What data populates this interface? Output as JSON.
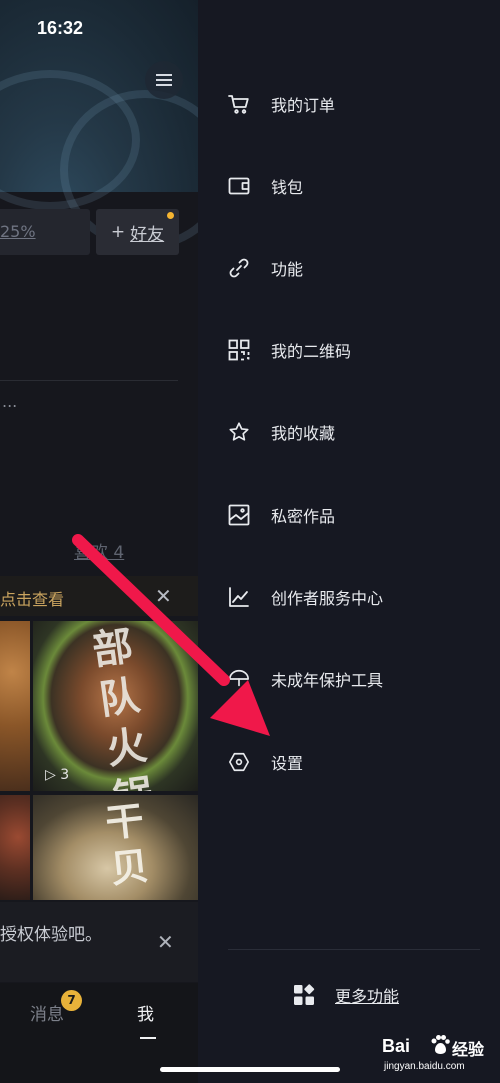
{
  "status_bar": {
    "time": "16:32"
  },
  "profile": {
    "percent_label": "25%",
    "add_friend_label": "+ 好友",
    "add_friend_text": "好友",
    "ellipsis": "...",
    "likes_label": "喜欢 4",
    "tip_text": "点击查看",
    "auth_text": "授权体验吧。",
    "thumbnails": [
      {
        "overlay_text": "部队火锅",
        "play_count": "3"
      },
      {
        "overlay_text": "干贝"
      }
    ]
  },
  "tabbar": {
    "messages_label": "消息",
    "messages_badge": "7",
    "me_label": "我"
  },
  "drawer": {
    "items": [
      {
        "label": "我的订单",
        "icon": "cart-icon"
      },
      {
        "label": "钱包",
        "icon": "wallet-icon"
      },
      {
        "label": "功能",
        "icon": "link-icon"
      },
      {
        "label": "我的二维码",
        "icon": "qrcode-icon"
      },
      {
        "label": "我的收藏",
        "icon": "star-icon"
      },
      {
        "label": "私密作品",
        "icon": "private-image-icon"
      },
      {
        "label": "创作者服务中心",
        "icon": "chart-icon"
      },
      {
        "label": "未成年保护工具",
        "icon": "umbrella-icon"
      },
      {
        "label": "设置",
        "icon": "settings-hexagon-icon"
      }
    ],
    "more_label": "更多功能"
  },
  "watermark": {
    "brand": "Bai",
    "suffix": "经验",
    "url": "jingyan.baidu.com"
  },
  "colors": {
    "drawer_bg": "#161822",
    "arrow": "#f0184a",
    "accent_yellow": "#e8b23a"
  }
}
